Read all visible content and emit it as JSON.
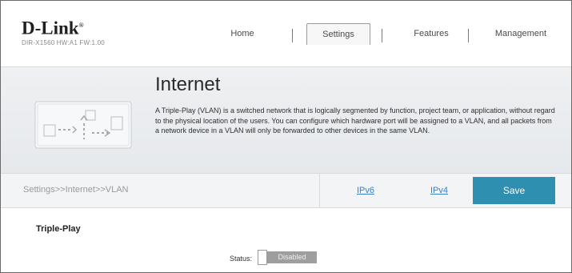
{
  "header": {
    "brand": "D-Link",
    "brand_tm": "®",
    "model": "DIR-X1560 HW:A1 FW:1.00",
    "nav": [
      {
        "label": "Home"
      },
      {
        "label": "Settings",
        "active": true
      },
      {
        "label": "Features"
      },
      {
        "label": "Management"
      }
    ]
  },
  "banner": {
    "title": "Internet",
    "description": "A Triple-Play (VLAN) is a switched network that is logically segmented by function, project team, or application, without regard to the physical location of the users. You can configure which hardware port will be assigned to a VLAN, and all packets from a network device in a VLAN will only be forwarded to other devices in the same VLAN.",
    "illustration_icon": "network-diagram-icon"
  },
  "toolbar": {
    "breadcrumb": "Settings>>Internet>>VLAN",
    "ipv6_label": "IPv6",
    "ipv4_label": "IPv4",
    "save_label": "Save",
    "save_color": "#2f8fb0"
  },
  "triple_play": {
    "section_title": "Triple-Play",
    "status_label": "Status:",
    "status_value": "Disabled"
  }
}
